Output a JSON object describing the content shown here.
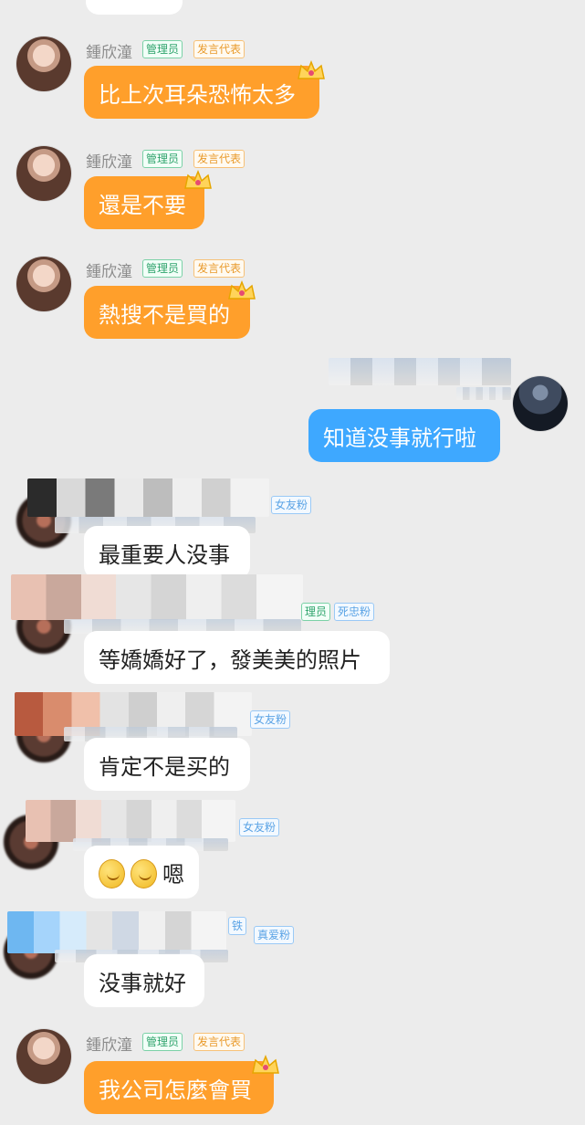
{
  "chat": {
    "messages": [
      {
        "side": "left",
        "sender": "鍾欣潼",
        "badges": [
          "管理员",
          "发言代表"
        ],
        "text": "比上次耳朵恐怖太多",
        "has_crown": true
      },
      {
        "side": "left",
        "sender": "鍾欣潼",
        "badges": [
          "管理员",
          "发言代表"
        ],
        "text": "還是不要",
        "has_crown": true
      },
      {
        "side": "left",
        "sender": "鍾欣潼",
        "badges": [
          "管理员",
          "发言代表"
        ],
        "text": "熱搜不是買的",
        "has_crown": true
      },
      {
        "side": "right",
        "text": "知道没事就行啦"
      },
      {
        "side": "left",
        "badges": [
          "女友粉"
        ],
        "text": "最重要人没事"
      },
      {
        "side": "left",
        "badges": [
          "理员",
          "死忠粉"
        ],
        "text": "等嬌嬌好了，發美美的照片"
      },
      {
        "side": "left",
        "badges": [
          "女友粉"
        ],
        "text": "肯定不是买的"
      },
      {
        "side": "left",
        "badges": [
          "女友粉"
        ],
        "text": "嗯",
        "emoji_count": 2
      },
      {
        "side": "left",
        "badges": [
          "铁",
          "真爱粉"
        ],
        "text": "没事就好"
      },
      {
        "side": "left",
        "sender": "鍾欣潼",
        "badges": [
          "管理员",
          "发言代表"
        ],
        "text": "我公司怎麼會買",
        "has_crown": true
      }
    ]
  },
  "colors": {
    "background": "#ececec",
    "orange_bubble": "#ff9f2b",
    "blue_bubble": "#3ea8ff",
    "white_bubble": "#ffffff"
  },
  "icons": {
    "crown": "crown-icon",
    "emoji": "thinking-emoji-icon"
  }
}
